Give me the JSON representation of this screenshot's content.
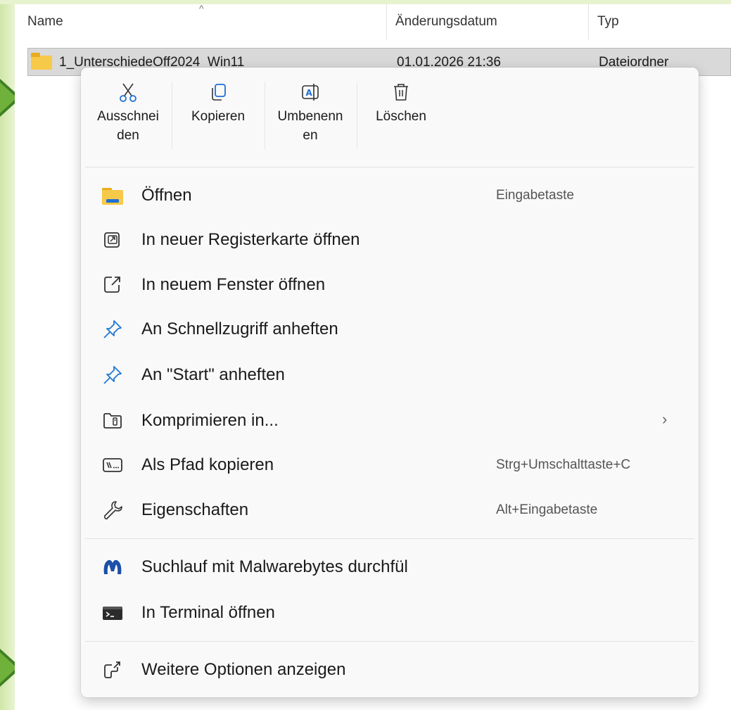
{
  "explorer": {
    "columns": {
      "name": "Name",
      "date": "Änderungsdatum",
      "type": "Typ"
    },
    "selected_row": {
      "name": "1_UnterschiedeOff2024_Win11",
      "date": "01.01.2026 21:36",
      "type": "Dateiordner"
    }
  },
  "context_menu": {
    "quick_actions": {
      "cut": [
        "Ausschnei",
        "den"
      ],
      "copy": [
        "Kopieren"
      ],
      "rename": [
        "Umbenenn",
        "en"
      ],
      "delete": [
        "Löschen"
      ]
    },
    "items": {
      "open": {
        "label": "Öffnen",
        "shortcut": "Eingabetaste"
      },
      "open_new_tab": {
        "label": "In neuer Registerkarte öffnen"
      },
      "open_new_window": {
        "label": "In neuem Fenster öffnen"
      },
      "pin_quick_access": {
        "label": "An Schnellzugriff anheften"
      },
      "pin_start": {
        "label": "An \"Start\" anheften"
      },
      "compress": {
        "label": "Komprimieren in...",
        "submenu_glyph": "›"
      },
      "copy_path": {
        "label": "Als Pfad kopieren",
        "shortcut": "Strg+Umschalttaste+C"
      },
      "properties": {
        "label": "Eigenschaften",
        "shortcut": "Alt+Eingabetaste"
      },
      "malwarebytes": {
        "label": "Suchlauf mit Malwarebytes durchfül"
      },
      "terminal": {
        "label": "In Terminal öffnen"
      },
      "more_options": {
        "label": "Weitere Optionen anzeigen"
      }
    }
  },
  "colors": {
    "accent_blue": "#1f6fd6",
    "pin_blue": "#1e78d4",
    "malwarebytes_blue": "#1b4fa8",
    "folder_yellow": "#f7c948"
  },
  "icons": {
    "cut": "scissors-icon",
    "copy": "copy-icon",
    "rename": "rename-icon",
    "delete": "trash-icon",
    "open": "folder-icon",
    "new_tab": "new-tab-icon",
    "new_window": "new-window-icon",
    "pin": "pin-icon",
    "compress": "zip-folder-icon",
    "path": "path-icon",
    "properties": "wrench-icon",
    "malwarebytes": "malwarebytes-icon",
    "terminal": "terminal-icon",
    "more": "more-options-icon"
  }
}
